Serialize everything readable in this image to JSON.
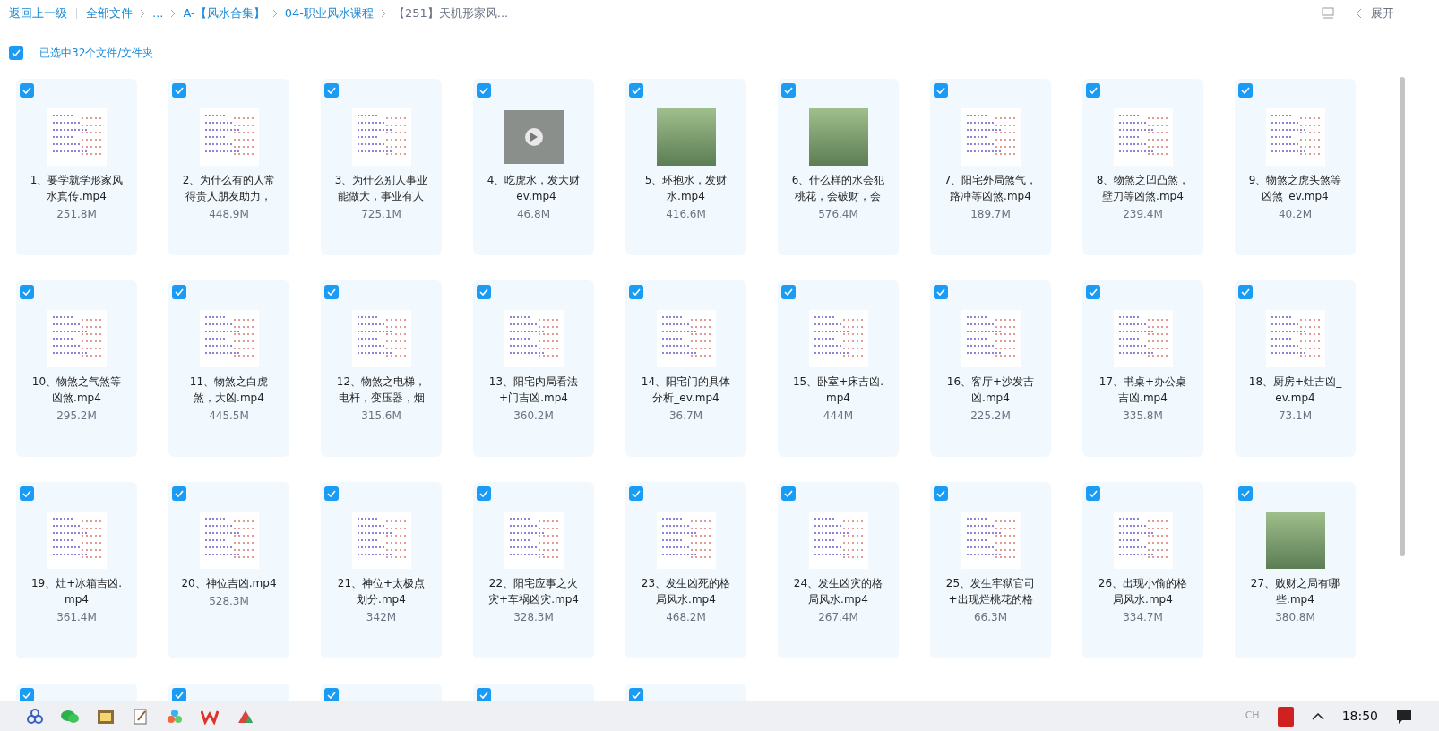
{
  "breadcrumb": {
    "back": "返回上一级",
    "items": [
      {
        "label": "全部文件",
        "current": false
      },
      {
        "label": "...",
        "current": false
      },
      {
        "label": "A-【风水合集】",
        "current": false
      },
      {
        "label": "04-职业风水课程",
        "current": false
      },
      {
        "label": "【251】天机形家风...",
        "current": true
      }
    ]
  },
  "header_right": {
    "expand_label": "展开"
  },
  "selection": {
    "checked": true,
    "label": "已选中32个文件/文件夹"
  },
  "files": [
    {
      "lines": [
        "1、要学就学形家风",
        "水真传.mp4"
      ],
      "size": "251.8M",
      "checked": true,
      "kind": "doc"
    },
    {
      "lines": [
        "2、为什么有的人常",
        "得贵人朋友助力，"
      ],
      "size": "448.9M",
      "checked": true,
      "kind": "doc"
    },
    {
      "lines": [
        "3、为什么别人事业",
        "能做大，事业有人"
      ],
      "size": "725.1M",
      "checked": true,
      "kind": "doc"
    },
    {
      "lines": [
        "4、吃虎水，发大财",
        "_ev.mp4"
      ],
      "size": "46.8M",
      "checked": true,
      "kind": "video"
    },
    {
      "lines": [
        "5、环抱水，发财",
        "水.mp4"
      ],
      "size": "416.6M",
      "checked": true,
      "kind": "photo"
    },
    {
      "lines": [
        "6、什么样的水会犯",
        "桃花，会破财，会"
      ],
      "size": "576.4M",
      "checked": true,
      "kind": "photo"
    },
    {
      "lines": [
        "7、阳宅外局煞气，",
        "路冲等凶煞.mp4"
      ],
      "size": "189.7M",
      "checked": true,
      "kind": "doc"
    },
    {
      "lines": [
        "8、物煞之凹凸煞，",
        "壁刀等凶煞.mp4"
      ],
      "size": "239.4M",
      "checked": true,
      "kind": "doc"
    },
    {
      "lines": [
        "9、物煞之虎头煞等",
        "凶煞_ev.mp4"
      ],
      "size": "40.2M",
      "checked": true,
      "kind": "doc"
    },
    {
      "lines": [
        "10、物煞之气煞等",
        "凶煞.mp4"
      ],
      "size": "295.2M",
      "checked": true,
      "kind": "doc"
    },
    {
      "lines": [
        "11、物煞之白虎",
        "煞，大凶.mp4"
      ],
      "size": "445.5M",
      "checked": true,
      "kind": "doc"
    },
    {
      "lines": [
        "12、物煞之电梯，",
        "电杆，变压器，烟"
      ],
      "size": "315.6M",
      "checked": true,
      "kind": "doc"
    },
    {
      "lines": [
        "13、阳宅内局看法",
        "+门吉凶.mp4"
      ],
      "size": "360.2M",
      "checked": true,
      "kind": "doc"
    },
    {
      "lines": [
        "14、阳宅门的具体",
        "分析_ev.mp4"
      ],
      "size": "36.7M",
      "checked": true,
      "kind": "doc"
    },
    {
      "lines": [
        "15、卧室+床吉凶.",
        "mp4"
      ],
      "size": "444M",
      "checked": true,
      "kind": "doc"
    },
    {
      "lines": [
        "16、客厅+沙发吉",
        "凶.mp4"
      ],
      "size": "225.2M",
      "checked": true,
      "kind": "doc"
    },
    {
      "lines": [
        "17、书桌+办公桌",
        "吉凶.mp4"
      ],
      "size": "335.8M",
      "checked": true,
      "kind": "doc"
    },
    {
      "lines": [
        "18、厨房+灶吉凶_",
        "ev.mp4"
      ],
      "size": "73.1M",
      "checked": true,
      "kind": "doc"
    },
    {
      "lines": [
        "19、灶+冰箱吉凶.",
        "mp4"
      ],
      "size": "361.4M",
      "checked": true,
      "kind": "doc"
    },
    {
      "lines": [
        "20、神位吉凶.mp4"
      ],
      "size": "528.3M",
      "checked": true,
      "kind": "doc"
    },
    {
      "lines": [
        "21、神位+太极点",
        "划分.mp4"
      ],
      "size": "342M",
      "checked": true,
      "kind": "doc"
    },
    {
      "lines": [
        "22、阳宅应事之火",
        "灾+车祸凶灾.mp4"
      ],
      "size": "328.3M",
      "checked": true,
      "kind": "doc"
    },
    {
      "lines": [
        "23、发生凶死的格",
        "局风水.mp4"
      ],
      "size": "468.2M",
      "checked": true,
      "kind": "doc"
    },
    {
      "lines": [
        "24、发生凶灾的格",
        "局风水.mp4"
      ],
      "size": "267.4M",
      "checked": true,
      "kind": "doc"
    },
    {
      "lines": [
        "25、发生牢狱官司",
        "+出现烂桃花的格"
      ],
      "size": "66.3M",
      "checked": true,
      "kind": "doc"
    },
    {
      "lines": [
        "26、出现小偷的格",
        "局风水.mp4"
      ],
      "size": "334.7M",
      "checked": true,
      "kind": "doc"
    },
    {
      "lines": [
        "27、败财之局有哪",
        "些.mp4"
      ],
      "size": "380.8M",
      "checked": true,
      "kind": "photo"
    },
    {
      "checked": true,
      "kind": "hidden"
    },
    {
      "checked": true,
      "kind": "hidden"
    },
    {
      "checked": true,
      "kind": "hidden"
    },
    {
      "checked": true,
      "kind": "hidden"
    },
    {
      "checked": true,
      "kind": "hidden"
    }
  ],
  "taskbar": {
    "language": "CH",
    "time": "18:50"
  }
}
